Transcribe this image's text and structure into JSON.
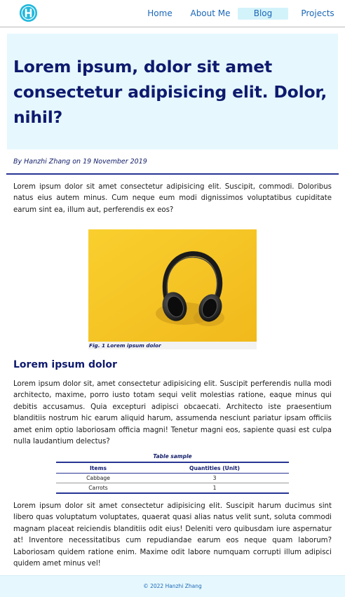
{
  "nav": {
    "links": [
      {
        "label": "Home",
        "active": false
      },
      {
        "label": "About Me",
        "active": false
      },
      {
        "label": "Blog",
        "active": true
      },
      {
        "label": "Projects",
        "active": false
      }
    ],
    "accent_color": "#22b8dc"
  },
  "article": {
    "title": "Lorem ipsum, dolor sit amet consectetur adipisicing elit. Dolor, nihil?",
    "byline": "By Hanzhi Zhang on 19 November 2019",
    "intro": "Lorem ipsum dolor sit amet consectetur adipisicing elit. Suscipit, commodi. Doloribus natus eius autem minus. Cum neque eum modi dignissimos voluptatibus cupiditate earum sint ea, illum aut, perferendis ex eos?",
    "figure": {
      "caption": "Fig. 1 Lorem ipsum dolor",
      "image": "headphones-on-yellow"
    },
    "section_title": "Lorem ipsum dolor",
    "section_paragraph": "Lorem ipsum dolor sit, amet consectetur adipisicing elit. Suscipit perferendis nulla modi architecto, maxime, porro iusto totam sequi velit molestias ratione, eaque minus qui debitis accusamus. Quia excepturi adipisci obcaecati. Architecto iste praesentium blanditiis nostrum hic earum aliquid harum, assumenda nesciunt pariatur ipsam officiis amet enim optio laboriosam officia magni! Tenetur magni eos, sapiente quasi est culpa nulla laudantium delectus?",
    "table": {
      "caption": "Table sample",
      "headers": [
        "Items",
        "Quantities (Unit)"
      ],
      "rows": [
        [
          "Cabbage",
          "3"
        ],
        [
          "Carrots",
          "1"
        ]
      ]
    },
    "closing_paragraph": "Lorem ipsum dolor sit amet consectetur adipisicing elit. Suscipit harum ducimus sint libero quas voluptatum voluptates, quaerat quasi alias natus velit sunt, soluta commodi magnam placeat reiciendis blanditiis odit eius! Deleniti vero quibusdam iure aspernatur at! Inventore necessitatibus cum repudiandae earum eos neque quam laborum? Laboriosam quidem ratione enim. Maxime odit labore numquam corrupti illum adipisci quidem amet minus vel!"
  },
  "footer": {
    "copyright": "© 2022 Hanzhi Zhang"
  },
  "colors": {
    "title": "#0e1a6e",
    "link": "#1b67b8",
    "hero_bg": "#e6f8fd",
    "rule": "#283593",
    "figure_bg": "#f6c326"
  }
}
